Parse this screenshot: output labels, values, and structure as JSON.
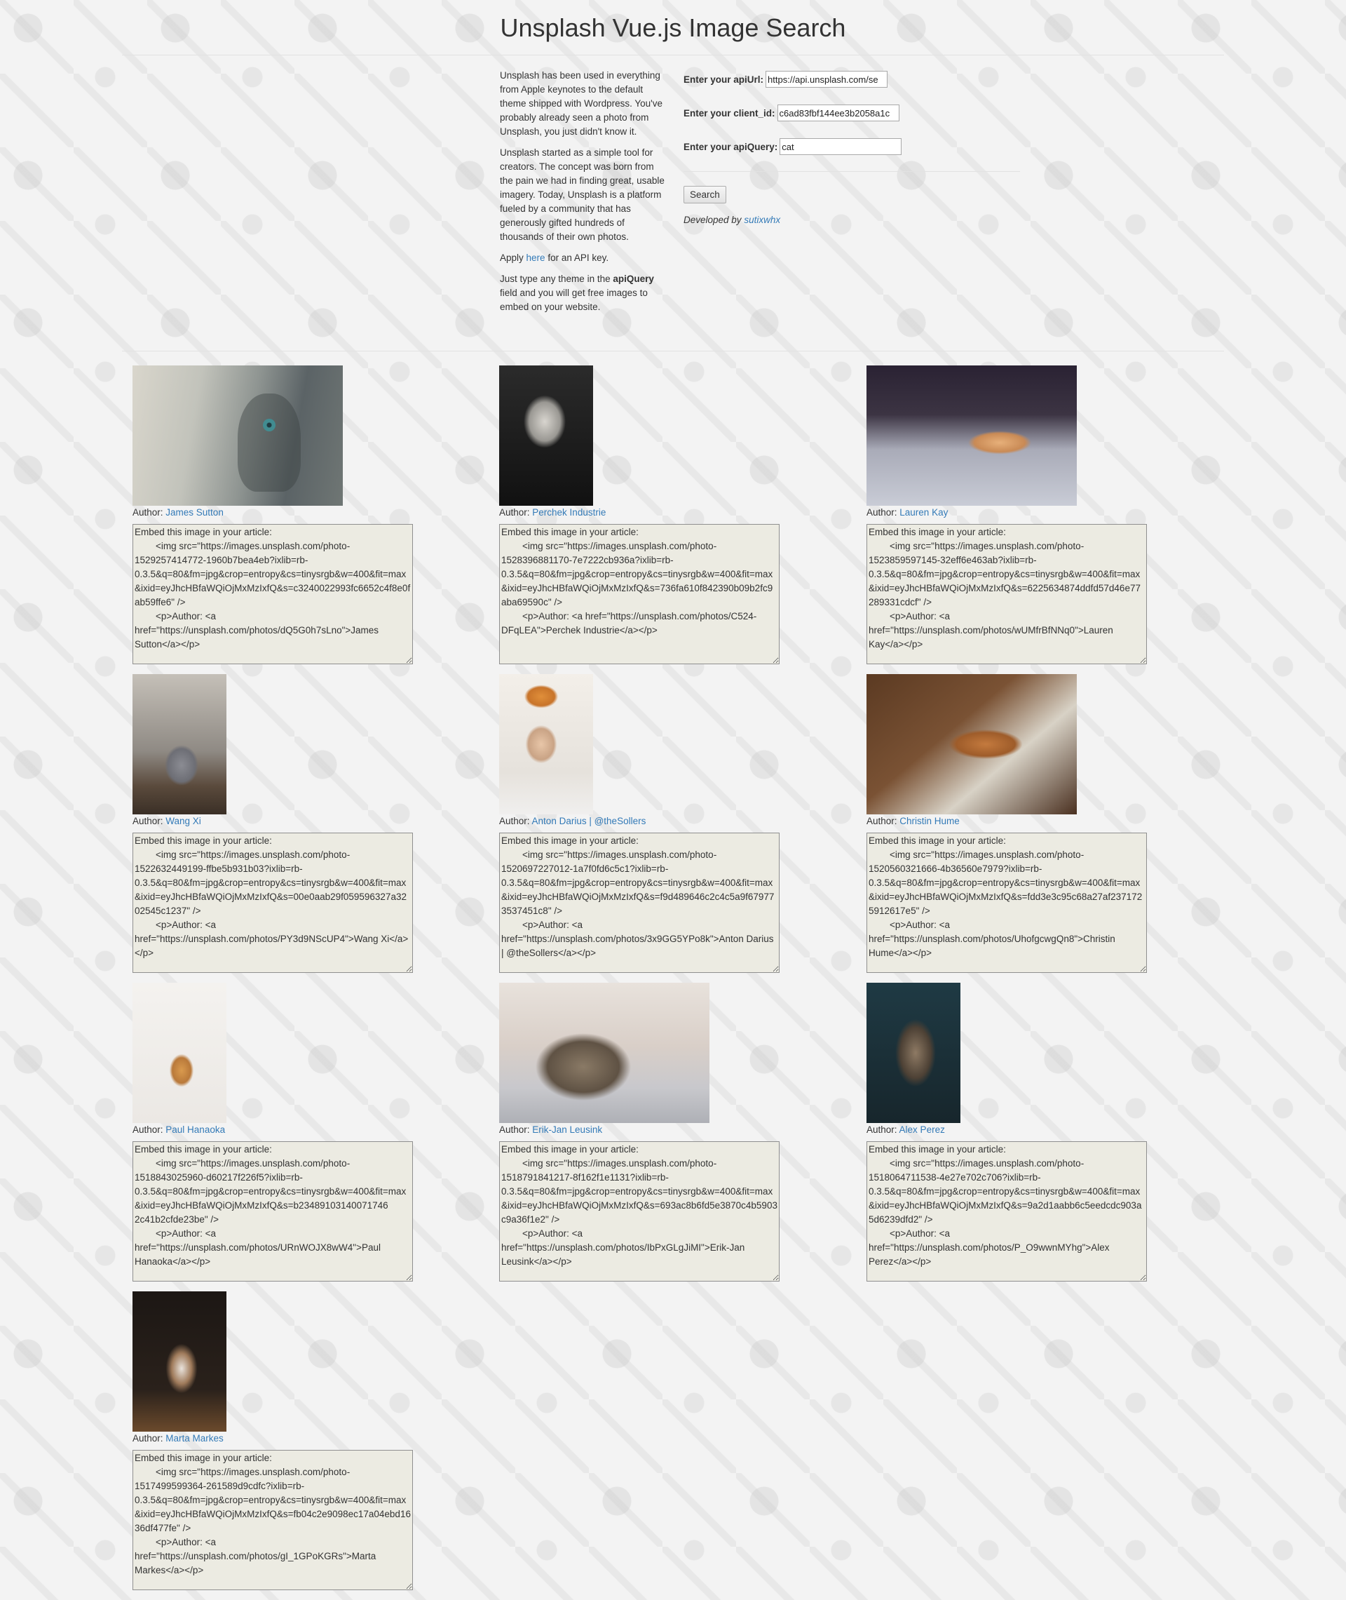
{
  "header": {
    "title": "Unsplash Vue.js Image Search"
  },
  "intro": {
    "p1": "Unsplash has been used in everything from Apple keynotes to the default theme shipped with Wordpress. You've probably already seen a photo from Unsplash, you just didn't know it.",
    "p2": "Unsplash started as a simple tool for creators. The concept was born from the pain we had in finding great, usable imagery. Today, Unsplash is a platform fueled by a community that has generously gifted hundreds of thousands of their own photos.",
    "p3_before": "Apply ",
    "p3_link": "here",
    "p3_after": " for an API key.",
    "p4_before": "Just type any theme in the ",
    "p4_bold": "apiQuery",
    "p4_after": " field and you will get free images to embed on your website."
  },
  "form": {
    "api_url_label": "Enter your apiUrl:",
    "api_url_value": "https://api.unsplash.com/se",
    "client_id_label": "Enter your client_id:",
    "client_id_value": "c6ad83fbf144ee3b2058a1c",
    "api_query_label": "Enter your apiQuery:",
    "api_query_value": "cat",
    "search_label": "Search",
    "developed_by": "Developed by ",
    "developer": "sutixwhx"
  },
  "results": [
    {
      "author_label": "Author: ",
      "author": "James Sutton",
      "embed": "Embed this image in your article:\n        <img src=\"https://images.unsplash.com/photo-1529257414772-1960b7bea4eb?ixlib=rb-0.3.5&q=80&fm=jpg&crop=entropy&cs=tinysrgb&w=400&fit=max&ixid=eyJhcHBfaWQiOjMxMzIxfQ&s=c3240022993fc6652c4f8e0fab59ffe6\" />\n        <p>Author: <a href=\"https://unsplash.com/photos/dQ5G0h7sLno\">James Sutton</a></p>"
    },
    {
      "author_label": "Author: ",
      "author": "Perchek Industrie",
      "embed": "Embed this image in your article:\n        <img src=\"https://images.unsplash.com/photo-1528396881170-7e7222cb936a?ixlib=rb-0.3.5&q=80&fm=jpg&crop=entropy&cs=tinysrgb&w=400&fit=max&ixid=eyJhcHBfaWQiOjMxMzIxfQ&s=736fa610f842390b09b2fc9aba69590c\" />\n        <p>Author: <a href=\"https://unsplash.com/photos/C524-DFqLEA\">Perchek Industrie</a></p>"
    },
    {
      "author_label": "Author: ",
      "author": "Lauren Kay",
      "embed": "Embed this image in your article:\n        <img src=\"https://images.unsplash.com/photo-1523859597145-32eff6e463ab?ixlib=rb-0.3.5&q=80&fm=jpg&crop=entropy&cs=tinysrgb&w=400&fit=max&ixid=eyJhcHBfaWQiOjMxMzIxfQ&s=6225634874ddfd57d46e77289331cdcf\" />\n        <p>Author: <a href=\"https://unsplash.com/photos/wUMfrBfNNq0\">Lauren Kay</a></p>"
    },
    {
      "author_label": "Author: ",
      "author": "Wang Xi",
      "embed": "Embed this image in your article:\n        <img src=\"https://images.unsplash.com/photo-1522632449199-ffbe5b931b03?ixlib=rb-0.3.5&q=80&fm=jpg&crop=entropy&cs=tinysrgb&w=400&fit=max&ixid=eyJhcHBfaWQiOjMxMzIxfQ&s=00e0aab29f059596327a3202545c1237\" />\n        <p>Author: <a href=\"https://unsplash.com/photos/PY3d9NScUP4\">Wang Xi</a></p>"
    },
    {
      "author_label": "Author: ",
      "author": "Anton Darius | @theSollers",
      "embed": "Embed this image in your article:\n        <img src=\"https://images.unsplash.com/photo-1520697227012-1a7f0fd6c5c1?ixlib=rb-0.3.5&q=80&fm=jpg&crop=entropy&cs=tinysrgb&w=400&fit=max&ixid=eyJhcHBfaWQiOjMxMzIxfQ&s=f9d489646c2c4c5a9f679773537451c8\" />\n        <p>Author: <a href=\"https://unsplash.com/photos/3x9GG5YPo8k\">Anton Darius | @theSollers</a></p>"
    },
    {
      "author_label": "Author: ",
      "author": "Christin Hume",
      "embed": "Embed this image in your article:\n        <img src=\"https://images.unsplash.com/photo-1520560321666-4b36560e7979?ixlib=rb-0.3.5&q=80&fm=jpg&crop=entropy&cs=tinysrgb&w=400&fit=max&ixid=eyJhcHBfaWQiOjMxMzIxfQ&s=fdd3e3c95c68a27af2371725912617e5\" />\n        <p>Author: <a href=\"https://unsplash.com/photos/UhofgcwgQn8\">Christin Hume</a></p>"
    },
    {
      "author_label": "Author: ",
      "author": "Paul Hanaoka",
      "embed": "Embed this image in your article:\n        <img src=\"https://images.unsplash.com/photo-1518843025960-d60217f226f5?ixlib=rb-0.3.5&q=80&fm=jpg&crop=entropy&cs=tinysrgb&w=400&fit=max&ixid=eyJhcHBfaWQiOjMxMzIxfQ&s=b23489103140071746 2c41b2cfde23be\" />\n        <p>Author: <a href=\"https://unsplash.com/photos/URnWOJX8wW4\">Paul Hanaoka</a></p>"
    },
    {
      "author_label": "Author: ",
      "author": "Erik-Jan Leusink",
      "embed": "Embed this image in your article:\n        <img src=\"https://images.unsplash.com/photo-1518791841217-8f162f1e1131?ixlib=rb-0.3.5&q=80&fm=jpg&crop=entropy&cs=tinysrgb&w=400&fit=max&ixid=eyJhcHBfaWQiOjMxMzIxfQ&s=693ac8b6fd5e3870c4b5903c9a36f1e2\" />\n        <p>Author: <a href=\"https://unsplash.com/photos/IbPxGLgJiMI\">Erik-Jan Leusink</a></p>"
    },
    {
      "author_label": "Author: ",
      "author": "Alex Perez",
      "embed": "Embed this image in your article:\n        <img src=\"https://images.unsplash.com/photo-1518064711538-4e27e702c706?ixlib=rb-0.3.5&q=80&fm=jpg&crop=entropy&cs=tinysrgb&w=400&fit=max&ixid=eyJhcHBfaWQiOjMxMzIxfQ&s=9a2d1aabb6c5eedcdc903a5d6239dfd2\" />\n        <p>Author: <a href=\"https://unsplash.com/photos/P_O9wwnMYhg\">Alex Perez</a></p>"
    },
    {
      "author_label": "Author: ",
      "author": "Marta Markes",
      "embed": "Embed this image in your article:\n        <img src=\"https://images.unsplash.com/photo-1517499599364-261589d9cdfc?ixlib=rb-0.3.5&q=80&fm=jpg&crop=entropy&cs=tinysrgb&w=400&fit=max&ixid=eyJhcHBfaWQiOjMxMzIxfQ&s=fb04c2e9098ec17a04ebd1636df477fe\" />\n        <p>Author: <a href=\"https://unsplash.com/photos/gI_1GPoKGRs\">Marta Markes</a></p>"
    }
  ],
  "colors": {
    "link": "#337ab7",
    "textarea_bg": "#ecebe2",
    "page_bg": "#f3f3f3"
  }
}
